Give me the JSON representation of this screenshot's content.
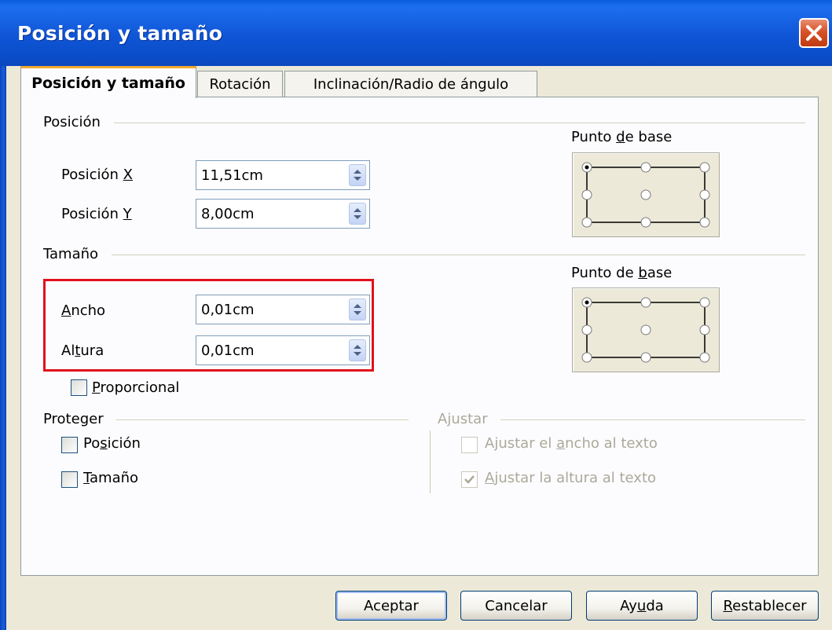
{
  "window": {
    "title": "Posición y tamaño"
  },
  "tabs": [
    {
      "label": "Posición y tamaño",
      "active": true
    },
    {
      "label": "Rotación",
      "active": false
    },
    {
      "label": "Inclinación/Radio de ángulo",
      "active": false
    }
  ],
  "position": {
    "group_label": "Posición",
    "x_label_pre": "Posición ",
    "x_label_key": "X",
    "x_value": "11,51cm",
    "y_label_pre": "Posición ",
    "y_label_key": "Y",
    "y_value": "8,00cm",
    "base_point_pre": "Punto ",
    "base_point_key": "d",
    "base_point_post": "e base"
  },
  "size": {
    "group_label": "Tamaño",
    "width_key": "A",
    "width_post": "ncho",
    "width_value": "0,01cm",
    "height_pre": "Al",
    "height_key": "t",
    "height_post": "ura",
    "height_value": "0,01cm",
    "proportional_key": "P",
    "proportional_post": "roporcional",
    "proportional_checked": false,
    "base_point_pre": "Punto de ",
    "base_point_key": "b",
    "base_point_post": "ase"
  },
  "protect": {
    "group_label": "Proteger",
    "position_pre": "Po",
    "position_key": "s",
    "position_post": "ición",
    "position_checked": false,
    "size_key": "T",
    "size_post": "amaño",
    "size_checked": false
  },
  "adjust": {
    "group_label": "Ajustar",
    "fit_width_pre": "Ajustar el ",
    "fit_width_key": "a",
    "fit_width_post": "ncho al texto",
    "fit_width_checked": false,
    "fit_height_key": "A",
    "fit_height_post": "justar la altura al texto",
    "fit_height_checked": true
  },
  "buttons": {
    "ok": "Aceptar",
    "cancel": "Cancelar",
    "help_pre": "Ay",
    "help_key": "u",
    "help_post": "da",
    "reset_key": "R",
    "reset_post": "establecer"
  },
  "colors": {
    "highlight": "#e0111d",
    "titlebar": "#0a4dc8",
    "active_tab_accent": "#f0a830"
  },
  "icons": {
    "close": "close-icon",
    "spin": "spin-arrows-icon",
    "check": "checkmark-icon"
  }
}
